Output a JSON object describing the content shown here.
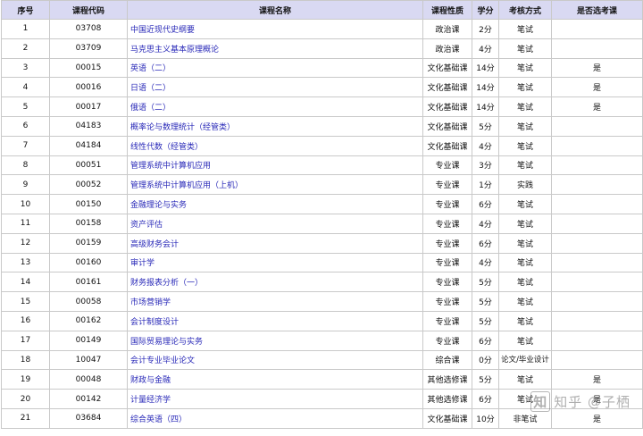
{
  "table": {
    "headers": [
      "序号",
      "课程代码",
      "课程名称",
      "课程性质",
      "学分",
      "考核方式",
      "是否选考课"
    ],
    "rows": [
      {
        "no": "1",
        "code": "03708",
        "name": "中国近现代史纲要",
        "type": "政治课",
        "credit": "2分",
        "exam": "笔试",
        "elective": ""
      },
      {
        "no": "2",
        "code": "03709",
        "name": "马克思主义基本原理概论",
        "type": "政治课",
        "credit": "4分",
        "exam": "笔试",
        "elective": ""
      },
      {
        "no": "3",
        "code": "00015",
        "name": "英语（二）",
        "type": "文化基础课",
        "credit": "14分",
        "exam": "笔试",
        "elective": "是"
      },
      {
        "no": "4",
        "code": "00016",
        "name": "日语（二）",
        "type": "文化基础课",
        "credit": "14分",
        "exam": "笔试",
        "elective": "是"
      },
      {
        "no": "5",
        "code": "00017",
        "name": "俄语（二）",
        "type": "文化基础课",
        "credit": "14分",
        "exam": "笔试",
        "elective": "是"
      },
      {
        "no": "6",
        "code": "04183",
        "name": "概率论与数理统计（经管类）",
        "type": "文化基础课",
        "credit": "5分",
        "exam": "笔试",
        "elective": ""
      },
      {
        "no": "7",
        "code": "04184",
        "name": "线性代数（经管类）",
        "type": "文化基础课",
        "credit": "4分",
        "exam": "笔试",
        "elective": ""
      },
      {
        "no": "8",
        "code": "00051",
        "name": "管理系统中计算机应用",
        "type": "专业课",
        "credit": "3分",
        "exam": "笔试",
        "elective": ""
      },
      {
        "no": "9",
        "code": "00052",
        "name": "管理系统中计算机应用（上机）",
        "type": "专业课",
        "credit": "1分",
        "exam": "实践",
        "elective": ""
      },
      {
        "no": "10",
        "code": "00150",
        "name": "金融理论与实务",
        "type": "专业课",
        "credit": "6分",
        "exam": "笔试",
        "elective": ""
      },
      {
        "no": "11",
        "code": "00158",
        "name": "资产评估",
        "type": "专业课",
        "credit": "4分",
        "exam": "笔试",
        "elective": ""
      },
      {
        "no": "12",
        "code": "00159",
        "name": "高级财务会计",
        "type": "专业课",
        "credit": "6分",
        "exam": "笔试",
        "elective": ""
      },
      {
        "no": "13",
        "code": "00160",
        "name": "审计学",
        "type": "专业课",
        "credit": "4分",
        "exam": "笔试",
        "elective": ""
      },
      {
        "no": "14",
        "code": "00161",
        "name": "财务报表分析（一）",
        "type": "专业课",
        "credit": "5分",
        "exam": "笔试",
        "elective": ""
      },
      {
        "no": "15",
        "code": "00058",
        "name": "市场营销学",
        "type": "专业课",
        "credit": "5分",
        "exam": "笔试",
        "elective": ""
      },
      {
        "no": "16",
        "code": "00162",
        "name": "会计制度设计",
        "type": "专业课",
        "credit": "5分",
        "exam": "笔试",
        "elective": ""
      },
      {
        "no": "17",
        "code": "00149",
        "name": "国际贸易理论与实务",
        "type": "专业课",
        "credit": "6分",
        "exam": "笔试",
        "elective": ""
      },
      {
        "no": "18",
        "code": "10047",
        "name": "会计专业毕业论文",
        "type": "综合课",
        "credit": "0分",
        "exam": "论文/毕业设计",
        "elective": ""
      },
      {
        "no": "19",
        "code": "00048",
        "name": "财政与金融",
        "type": "其他选修课",
        "credit": "5分",
        "exam": "笔试",
        "elective": "是"
      },
      {
        "no": "20",
        "code": "00142",
        "name": "计量经济学",
        "type": "其他选修课",
        "credit": "6分",
        "exam": "笔试",
        "elective": "是"
      },
      {
        "no": "21",
        "code": "03684",
        "name": "综合英语（四）",
        "type": "文化基础课",
        "credit": "10分",
        "exam": "非笔试",
        "elective": "是"
      }
    ]
  },
  "watermark": {
    "logo": "知",
    "text": "知乎 @子栖"
  }
}
